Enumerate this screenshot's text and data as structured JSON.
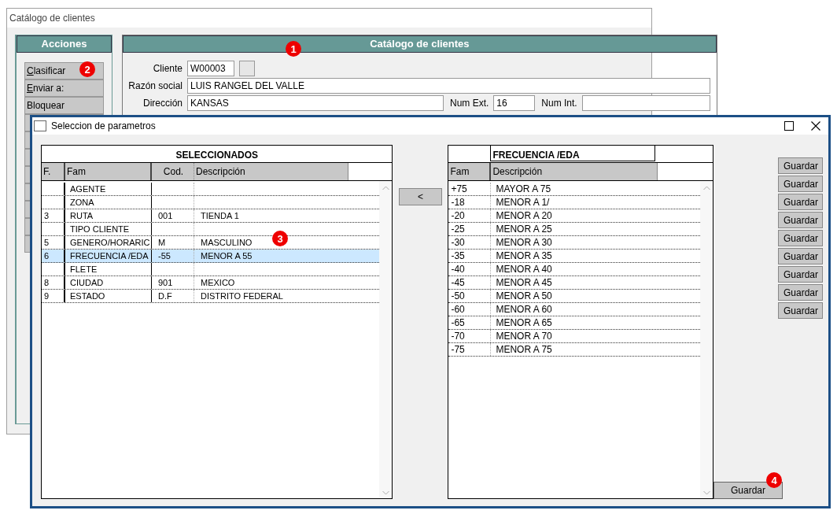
{
  "back_window": {
    "title": "Catálogo de clientes",
    "actions": {
      "title": "Acciones",
      "items": [
        {
          "label": "Clasificar",
          "underline_first": true
        },
        {
          "label": "Enviar a:",
          "underline_first": true
        },
        {
          "label": "Bloquear",
          "underline_first": false
        }
      ]
    },
    "catalog": {
      "title": "Catálogo de clientes",
      "cliente": {
        "label": "Cliente",
        "value": "W00003"
      },
      "razon_social": {
        "label": "Razón social",
        "value": "LUIS RANGEL DEL VALLE"
      },
      "direccion": {
        "label": "Dirección",
        "value": "KANSAS"
      },
      "num_ext": {
        "label": "Num Ext.",
        "value": "16"
      },
      "num_int": {
        "label": "Num Int."
      }
    }
  },
  "dialog": {
    "title": "Seleccion de parametros",
    "selected_table": {
      "title": "SELECCIONADOS",
      "columns": [
        "F.",
        "Fam",
        "Cod.",
        "Descripción"
      ],
      "rows": [
        {
          "f": "",
          "fam": "AGENTE",
          "cod": "",
          "desc": "",
          "selected": false
        },
        {
          "f": "",
          "fam": "ZONA",
          "cod": "",
          "desc": "",
          "selected": false
        },
        {
          "f": "3",
          "fam": "RUTA",
          "cod": "001",
          "desc": "TIENDA 1",
          "selected": false
        },
        {
          "f": "",
          "fam": "TIPO CLIENTE",
          "cod": "",
          "desc": "",
          "selected": false
        },
        {
          "f": "5",
          "fam": "GENERO/HORARIC",
          "cod": "M",
          "desc": "MASCULINO",
          "selected": false
        },
        {
          "f": "6",
          "fam": "FRECUENCIA /EDA",
          "cod": "-55",
          "desc": "MENOR A 55",
          "selected": true
        },
        {
          "f": "",
          "fam": "FLETE",
          "cod": "",
          "desc": "",
          "selected": false
        },
        {
          "f": "8",
          "fam": "CIUDAD",
          "cod": "901",
          "desc": "MEXICO",
          "selected": false
        },
        {
          "f": "9",
          "fam": "ESTADO",
          "cod": "D.F",
          "desc": "DISTRITO FEDERAL",
          "selected": false
        }
      ]
    },
    "move_button": "<",
    "options_table": {
      "title": "FRECUENCIA /EDA",
      "columns": [
        "Fam",
        "Descripción"
      ],
      "rows": [
        {
          "fam": "+75",
          "desc": "MAYOR A 75"
        },
        {
          "fam": "-18",
          "desc": "MENOR A 1/"
        },
        {
          "fam": "-20",
          "desc": "MENOR A 20"
        },
        {
          "fam": "-25",
          "desc": "MENOR A 25"
        },
        {
          "fam": "-30",
          "desc": "MENOR A 30"
        },
        {
          "fam": "-35",
          "desc": "MENOR A 35"
        },
        {
          "fam": "-40",
          "desc": "MENOR A 40"
        },
        {
          "fam": "-45",
          "desc": "MENOR A 45"
        },
        {
          "fam": "-50",
          "desc": "MENOR A 50"
        },
        {
          "fam": "-60",
          "desc": "MENOR A 60"
        },
        {
          "fam": "-65",
          "desc": "MENOR A 65"
        },
        {
          "fam": "-70",
          "desc": "MENOR A 70"
        },
        {
          "fam": "-75",
          "desc": "MENOR A 75"
        }
      ]
    },
    "side_buttons": [
      "Guardar",
      "Guardar",
      "Guardar",
      "Guardar",
      "Guardar",
      "Guardar",
      "Guardar",
      "Guardar",
      "Guardar"
    ],
    "save_button": "Guardar"
  },
  "callouts": [
    "1",
    "2",
    "3",
    "4"
  ]
}
